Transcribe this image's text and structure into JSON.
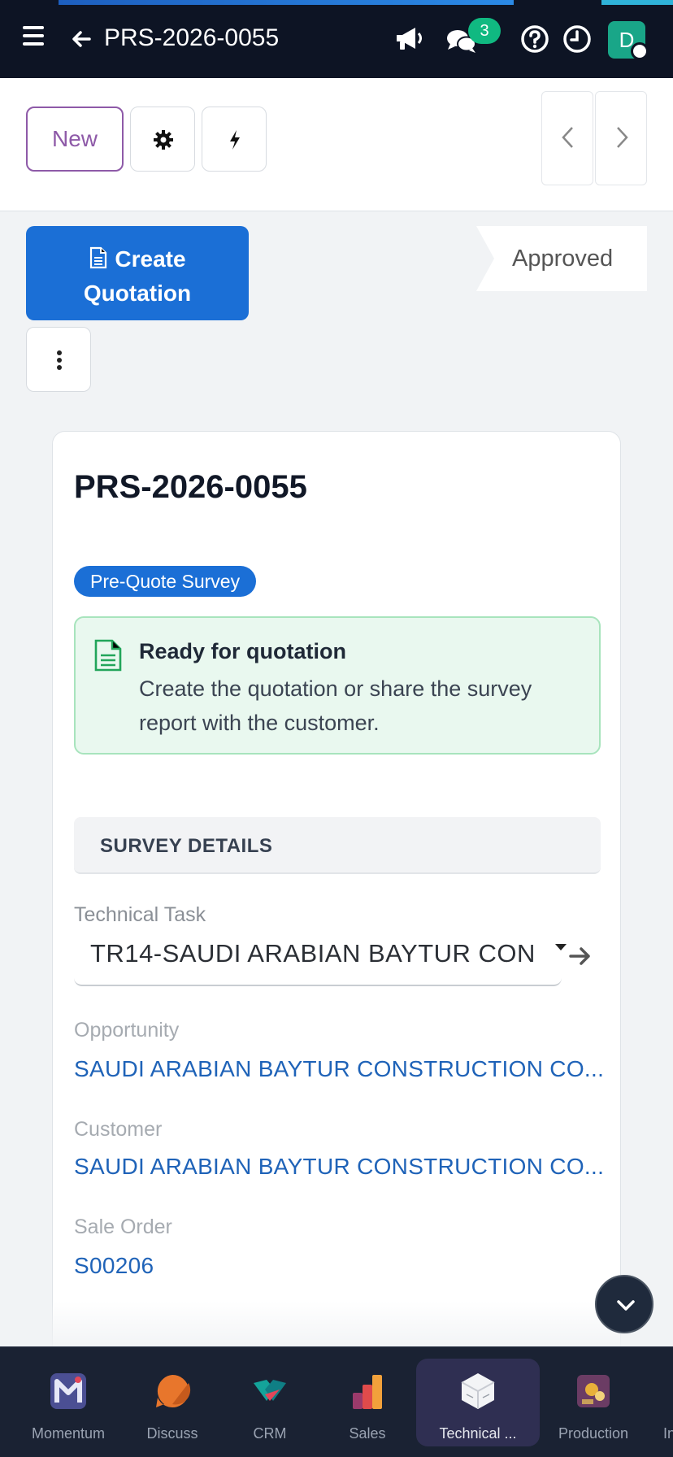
{
  "navbar": {
    "record_title": "PRS-2026-0055",
    "chat_badge": "3",
    "avatar_initial": "D"
  },
  "control_panel": {
    "new_label": "New"
  },
  "statusbar": {
    "create_quotation_line1": "Create",
    "create_quotation_line2": "Quotation",
    "stage": "Approved"
  },
  "form": {
    "title": "PRS-2026-0055",
    "type_badge": "Pre-Quote Survey",
    "alert": {
      "title": "Ready for quotation",
      "message": "Create the quotation or share the survey report with the customer."
    },
    "section_title": "SURVEY DETAILS",
    "fields": {
      "technical_task": {
        "label": "Technical Task",
        "value": "TR14-SAUDI ARABIAN BAYTUR CON"
      },
      "opportunity": {
        "label": "Opportunity",
        "value": "SAUDI ARABIAN BAYTUR CONSTRUCTION CO..."
      },
      "customer": {
        "label": "Customer",
        "value": "SAUDI ARABIAN BAYTUR CONSTRUCTION CO..."
      },
      "sale_order": {
        "label": "Sale Order",
        "value": "S00206"
      }
    }
  },
  "apps": [
    {
      "label": "Momentum",
      "icon": "momentum-app-icon"
    },
    {
      "label": "Discuss",
      "icon": "discuss-app-icon"
    },
    {
      "label": "CRM",
      "icon": "crm-app-icon"
    },
    {
      "label": "Sales",
      "icon": "sales-app-icon"
    },
    {
      "label": "Technical ...",
      "icon": "technical-app-icon",
      "active": true
    },
    {
      "label": "Production",
      "icon": "production-app-icon"
    },
    {
      "label": "In",
      "icon": "inventory-app-icon"
    }
  ],
  "colors": {
    "navbar_bg": "#0d1424",
    "primary": "#1b6fd6",
    "new_button": "#8e5aa8",
    "badge_green": "#10b981",
    "link": "#1f63b8"
  }
}
